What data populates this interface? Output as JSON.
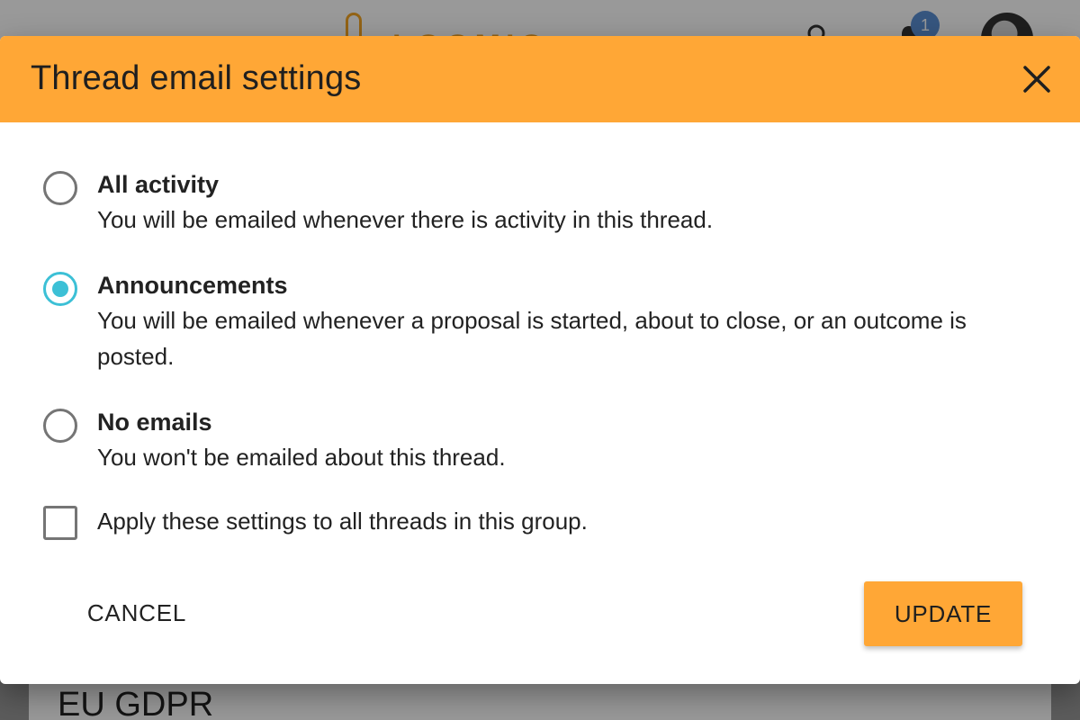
{
  "app_bar": {
    "logo_text": "LOOMIO",
    "notification_count": "1"
  },
  "background_card": {
    "title": "EU GDPR"
  },
  "dialog": {
    "title": "Thread email settings",
    "options": [
      {
        "label": "All activity",
        "description": "You will be emailed whenever there is activity in this thread.",
        "selected": false
      },
      {
        "label": "Announcements",
        "description": "You will be emailed whenever a proposal is started, about to close, or an outcome is posted.",
        "selected": true
      },
      {
        "label": "No emails",
        "description": "You won't be emailed about this thread.",
        "selected": false
      }
    ],
    "apply_all_label": "Apply these settings to all threads in this group.",
    "apply_all_checked": false,
    "cancel_label": "CANCEL",
    "update_label": "UPDATE"
  },
  "colors": {
    "header": "#ffa736",
    "accent_radio": "#3cc0d6",
    "badge": "#5b8fd4"
  },
  "icons": {
    "close": "close-icon",
    "search": "search-icon",
    "notifications": "bell-icon",
    "menu": "hamburger-icon"
  }
}
